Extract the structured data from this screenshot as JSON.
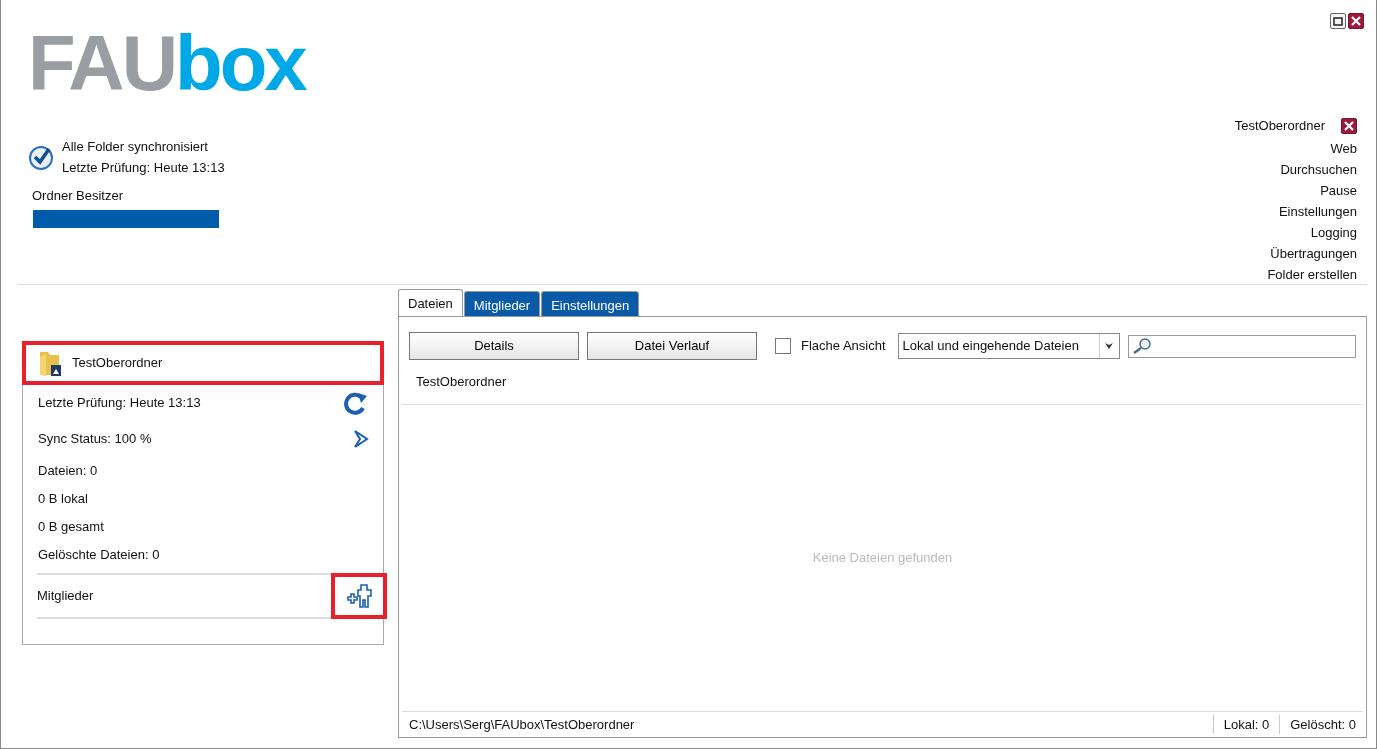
{
  "window": {
    "controls": [
      {
        "kind": "maximize"
      },
      {
        "kind": "close"
      }
    ]
  },
  "logo": {
    "part_1": "FAU",
    "part_2": "box"
  },
  "sync": {
    "status": "Alle Folder synchronisiert",
    "last_check": "Letzte Prüfung: Heute 13:13"
  },
  "owner": {
    "label": "Ordner Besitzer"
  },
  "menu": {
    "folder": "TestOberordner",
    "items": [
      "Web",
      "Durchsuchen",
      "Pause",
      "Einstellungen",
      "Logging",
      "Übertragungen",
      "Folder erstellen"
    ]
  },
  "folder_card": {
    "name": "TestOberordner",
    "highlighted": true,
    "rows": [
      {
        "text": "Letzte Prüfung: Heute 13:13",
        "kind": "refresh"
      },
      {
        "text": "Sync Status: 100 %",
        "kind": "next"
      },
      {
        "text": "Dateien: 0",
        "kind": "plain"
      },
      {
        "text": "0 B lokal",
        "kind": "plain"
      },
      {
        "text": "0 B gesamt",
        "kind": "plain"
      },
      {
        "text": "Gelöschte Dateien: 0",
        "kind": "plain"
      }
    ],
    "members": {
      "label": "Mitglieder",
      "highlighted": true
    }
  },
  "tabs": [
    {
      "label": "Dateien",
      "selected": true
    },
    {
      "label": "Mitglieder",
      "selected": false
    },
    {
      "label": "Einstellungen",
      "selected": false
    }
  ],
  "toolbar": {
    "buttons": [
      "Details",
      "Datei Verlauf"
    ],
    "flat_view": {
      "label": "Flache Ansicht",
      "checked": false
    },
    "filter": {
      "value": "Lokal und eingehende Dateien"
    }
  },
  "breadcrumb": "TestOberordner",
  "empty_message": "Keine Dateien gefunden",
  "status_bar": {
    "path": "C:\\Users\\Serg\\FAUbox\\TestOberordner",
    "local": "Lokal: 0",
    "deleted": "Gelöscht: 0"
  }
}
